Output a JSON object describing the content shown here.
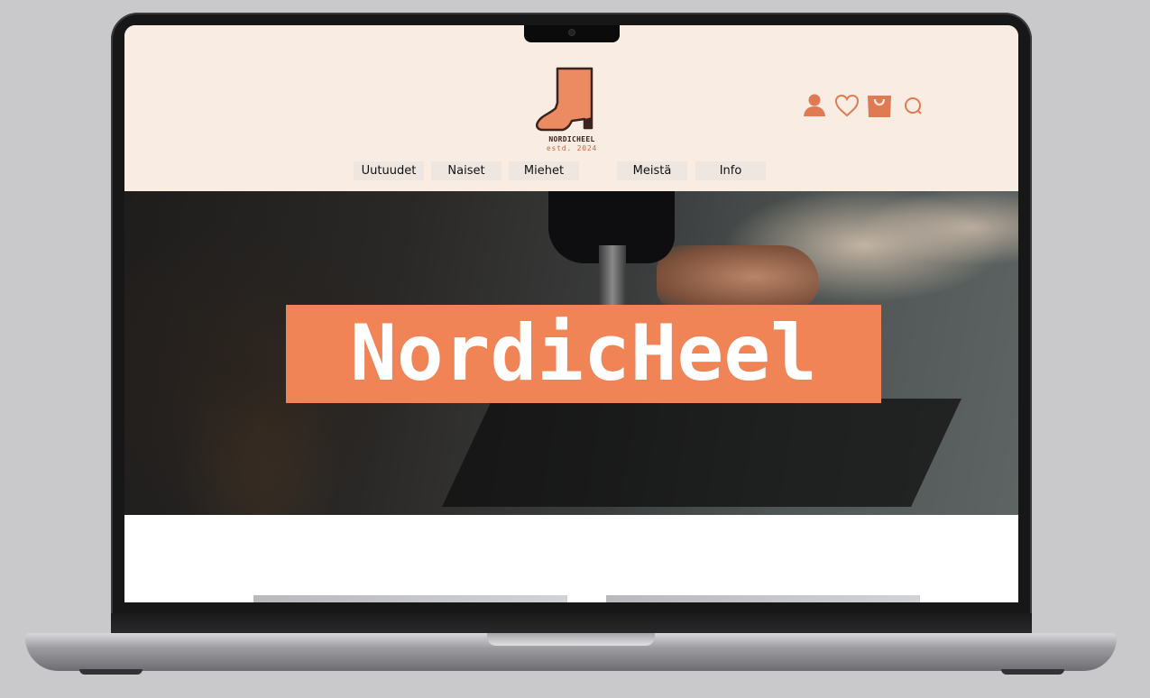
{
  "site": {
    "brand": "NordicHeel",
    "logo_name": "NORDICHEEL",
    "logo_estd": "estd. 2024",
    "hero_title": "NordicHeel"
  },
  "nav": {
    "items": [
      {
        "label": "Uutuudet"
      },
      {
        "label": "Naiset"
      },
      {
        "label": "Miehet"
      },
      {
        "label": "Meistä"
      },
      {
        "label": "Info"
      }
    ]
  },
  "header_icons": [
    "user-icon",
    "heart-icon",
    "shopping-bag-icon",
    "search-icon"
  ],
  "colors": {
    "header_bg": "#f9ece2",
    "accent": "#f08457",
    "nav_bg": "#ede6e1"
  }
}
